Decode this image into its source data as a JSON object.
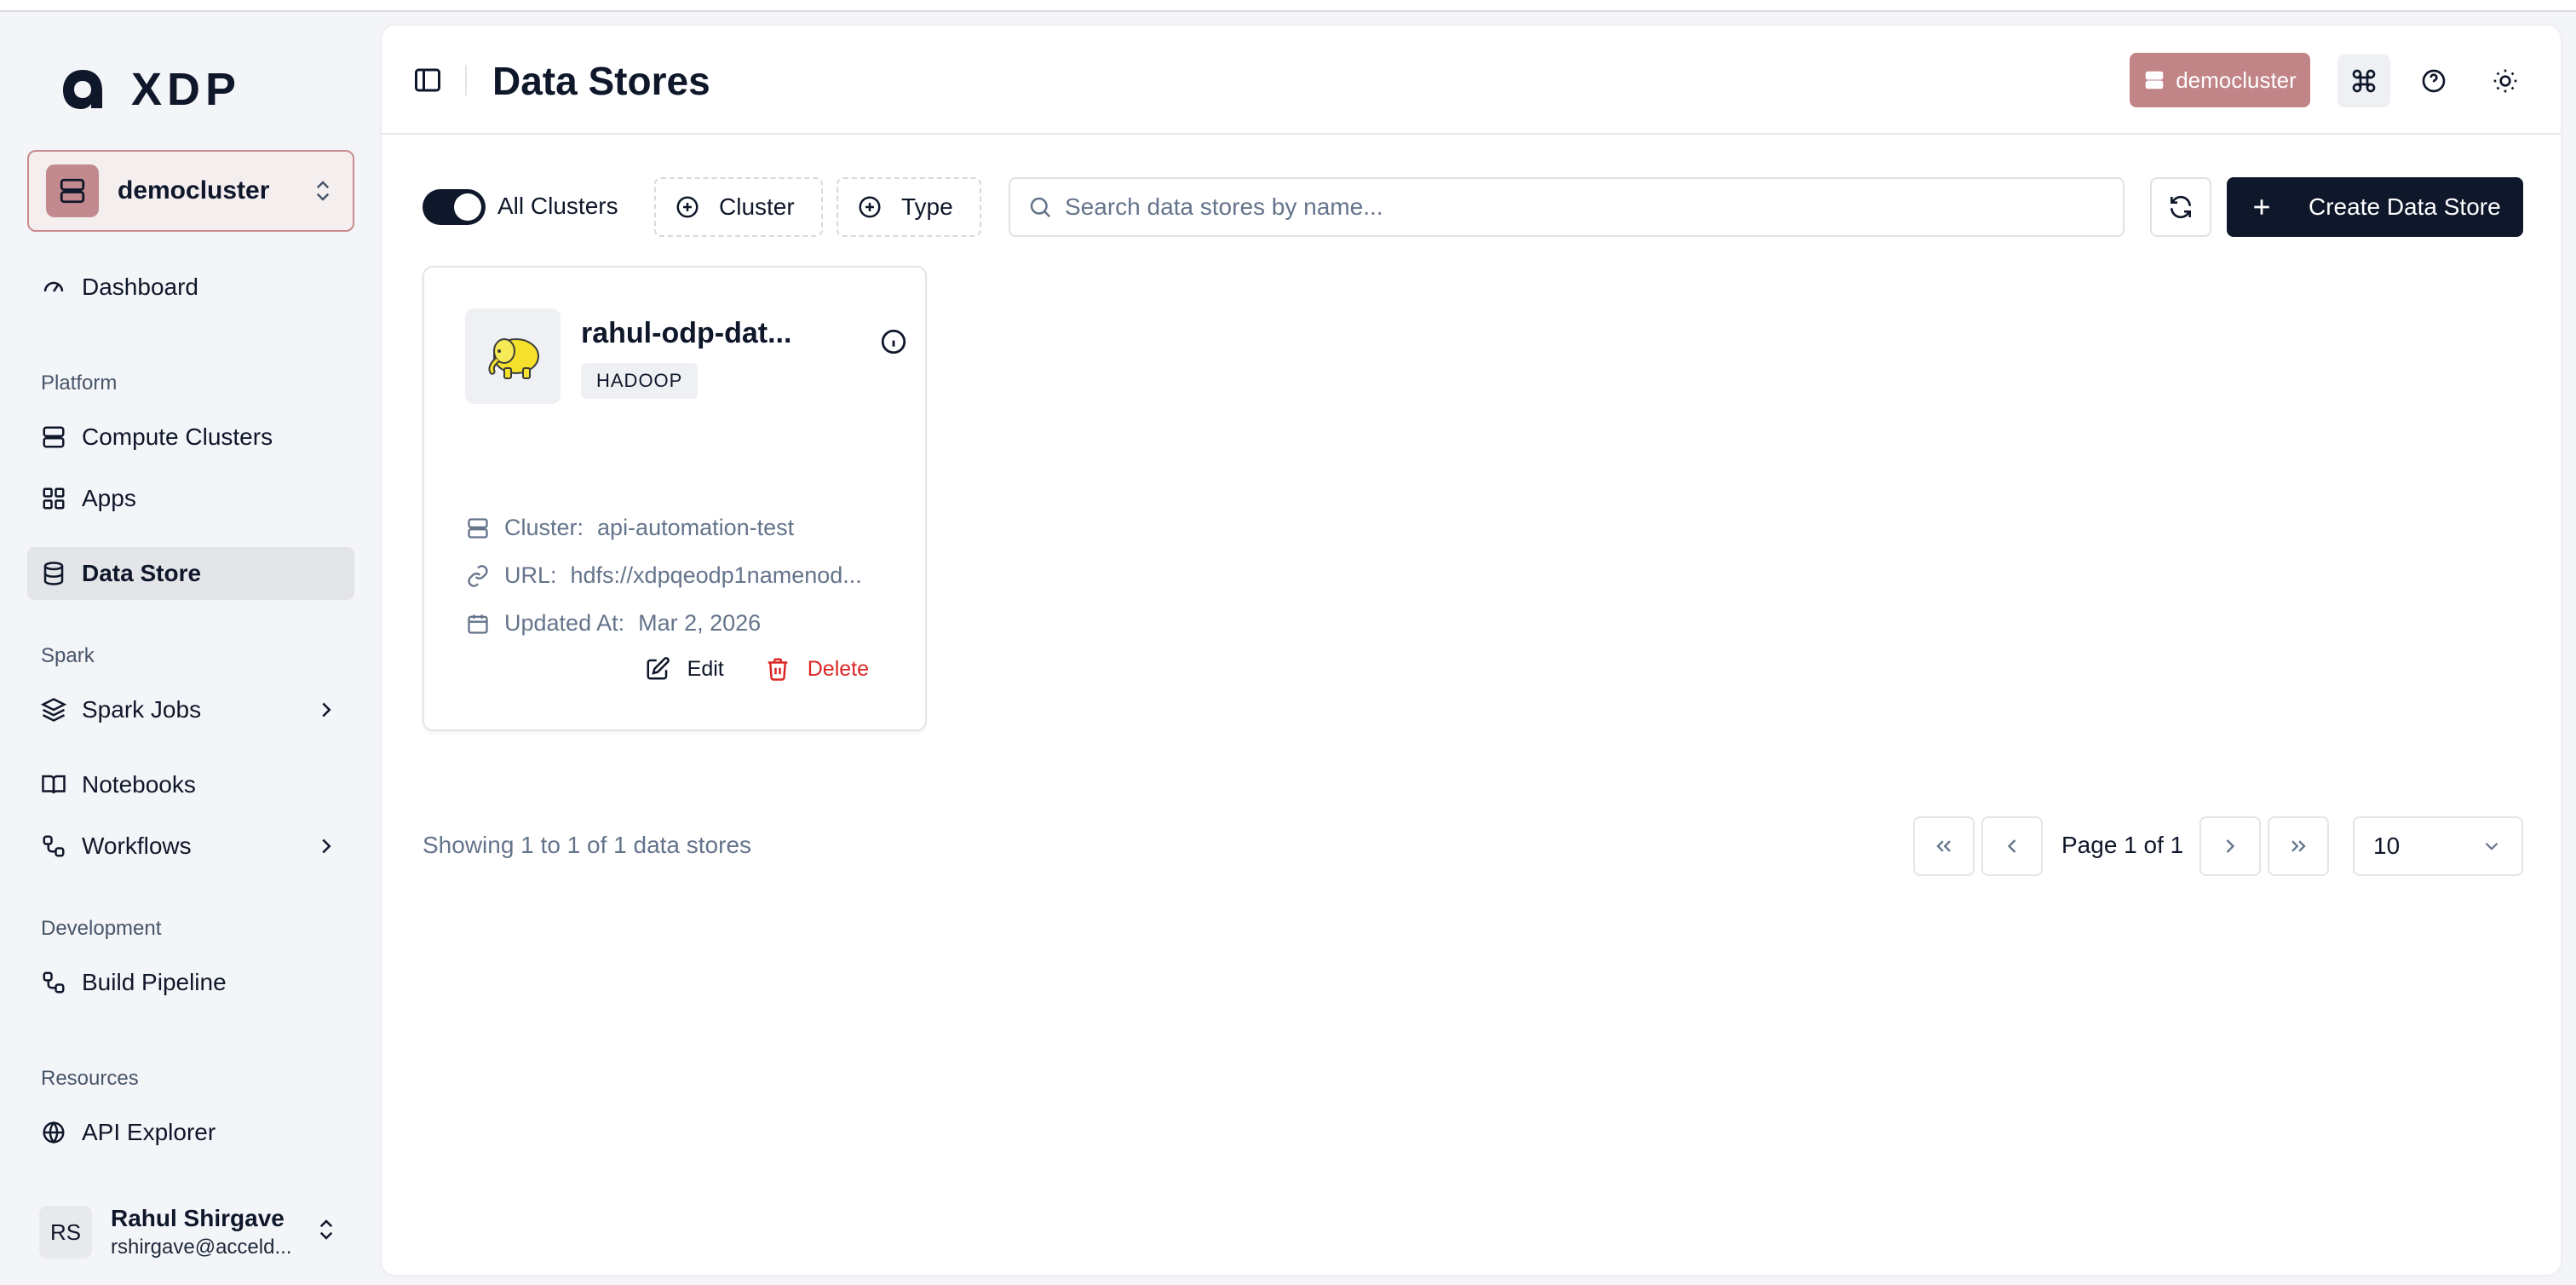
{
  "app": {
    "brand": "XDP"
  },
  "sidebar": {
    "cluster_switcher": {
      "label": "democluster"
    },
    "dashboard": "Dashboard",
    "sections": {
      "platform": "Platform",
      "spark": "Spark",
      "development": "Development",
      "resources": "Resources"
    },
    "items": {
      "compute_clusters": "Compute Clusters",
      "apps": "Apps",
      "data_store": "Data Store",
      "spark_jobs": "Spark Jobs",
      "notebooks": "Notebooks",
      "workflows": "Workflows",
      "build_pipeline": "Build Pipeline",
      "api_explorer": "API Explorer"
    },
    "user": {
      "initials": "RS",
      "name": "Rahul Shirgave",
      "email": "rshirgave@acceld..."
    }
  },
  "header": {
    "title": "Data Stores",
    "cluster_badge": "democluster"
  },
  "toolbar": {
    "all_clusters_label": "All Clusters",
    "all_clusters_on": true,
    "cluster_filter": "Cluster",
    "type_filter": "Type",
    "search_placeholder": "Search data stores by name...",
    "create_label": "Create Data Store"
  },
  "cards": [
    {
      "title": "rahul-odp-dat...",
      "type": "HADOOP",
      "cluster_label": "Cluster:",
      "cluster_value": "api-automation-test",
      "url_label": "URL:",
      "url_value": "hdfs://xdpqeodp1namenod...",
      "updated_label": "Updated At:",
      "updated_value": "Mar 2, 2026",
      "edit_label": "Edit",
      "delete_label": "Delete"
    }
  ],
  "pagination": {
    "showing": "Showing 1 to 1 of 1 data stores",
    "page_text": "Page 1 of 1",
    "page_size": "10"
  },
  "colors": {
    "accent_dark": "#0f172a",
    "cluster_badge": "#c18487",
    "danger": "#dc2626"
  }
}
